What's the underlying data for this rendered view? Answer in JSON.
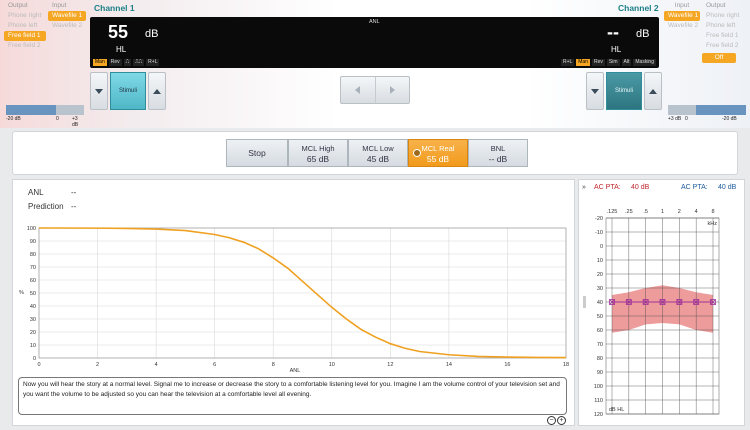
{
  "left_selector": {
    "output_header": "Output",
    "input_header": "Input",
    "outputs": [
      "Phone right",
      "Phone left",
      "Free field 1",
      "Free field 2"
    ],
    "inputs": [
      "Wavefile 1",
      "Wavefile 2"
    ],
    "selected_output": "Free field 1",
    "selected_input": "Wavefile 1"
  },
  "right_selector": {
    "input_header": "Input",
    "output_header": "Output",
    "outputs": [
      "Phone right",
      "Phone left",
      "Free field 1",
      "Free field 2"
    ],
    "inputs": [
      "Wavefile 1",
      "Wavefile 2"
    ],
    "selected_input": "Wavefile 1",
    "extra_button": "Off"
  },
  "channel1": {
    "title": "Channel 1",
    "level": "55",
    "unit": "dB",
    "hl": "HL",
    "modes": [
      "Man",
      "Rev",
      "⎍",
      "⎍⎍",
      "R+L"
    ],
    "active_mode": "Man",
    "stimuli_label": "Stimuli"
  },
  "channel2": {
    "title": "Channel 2",
    "level": "--",
    "unit": "dB",
    "hl": "HL",
    "modes": [
      "R+L",
      "Man",
      "Rev",
      "Sim",
      "Alt",
      "Masking"
    ],
    "active_mode": "Man",
    "stimuli_label": "Stimuli"
  },
  "display_center": "ANL",
  "slider_left": {
    "min": "-20 dB",
    "mid": "0",
    "max": "+3 dB"
  },
  "slider_right": {
    "min": "+3 dB",
    "mid": "0",
    "max": "-20 dB"
  },
  "test_panel": {
    "stop": "Stop",
    "mcl_high_label": "MCL High",
    "mcl_high_value": "65 dB",
    "mcl_low_label": "MCL Low",
    "mcl_low_value": "45 dB",
    "mcl_real_label": "MCL Real",
    "mcl_real_value": "55 dB",
    "bnl_label": "BNL",
    "bnl_value": "-- dB"
  },
  "results": {
    "anl_label": "ANL",
    "anl_value": "--",
    "prediction_label": "Prediction",
    "prediction_value": "--"
  },
  "chart_data": {
    "type": "line",
    "title": "",
    "xlabel": "ANL",
    "ylabel": "%",
    "xlim": [
      0,
      18
    ],
    "ylim": [
      0,
      100
    ],
    "xticks": [
      0,
      2,
      4,
      6,
      8,
      10,
      12,
      14,
      16,
      18
    ],
    "yticks": [
      0,
      10,
      20,
      30,
      40,
      50,
      60,
      70,
      80,
      90,
      100
    ],
    "grid": true,
    "series": [
      {
        "color": "#f0a020",
        "x": [
          0,
          2,
          3,
          4,
          5,
          6,
          6.5,
          7,
          7.5,
          8,
          8.5,
          9,
          9.5,
          10,
          10.5,
          11,
          11.5,
          12,
          12.5,
          13,
          14,
          15,
          16,
          17,
          18
        ],
        "y": [
          100,
          99.9,
          99.7,
          99.2,
          98,
          95,
          92.5,
          89,
          84,
          77,
          69,
          59,
          49,
          39,
          30,
          22,
          16,
          11,
          7.5,
          5,
          2.5,
          1.2,
          0.7,
          0.4,
          0.3
        ]
      }
    ]
  },
  "instructions": "Now you will hear the story at a normal level. Signal me to increase or decrease the story to a comfortable listening level for you. Imagine I am the volume control of your television set and you want the volume to be adjusted so you can hear the television at a comfortable level all evening.",
  "audiogram": {
    "left_pta_label": "AC PTA:",
    "left_pta_value": "40 dB",
    "right_pta_label": "AC PTA:",
    "right_pta_value": "40 dB",
    "freq_top": [
      ".125",
      ".25",
      ".5",
      "1",
      "2",
      "4",
      "8"
    ],
    "khz": "kHz",
    "db_levels": [
      "-20",
      "-10",
      "0",
      "10",
      "20",
      "30",
      "40",
      "50",
      "60",
      "70",
      "80",
      "90",
      "100",
      "110",
      "120"
    ],
    "unit_label": "dB HL",
    "marker_level": 40,
    "marker_count": 7,
    "band_color": "#e87a7a",
    "marker_color": "#a0309a"
  }
}
